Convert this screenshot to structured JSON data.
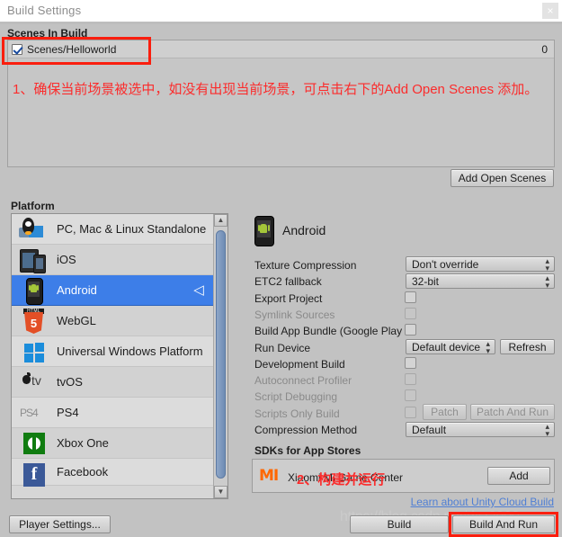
{
  "window": {
    "title": "Build Settings",
    "close_icon": "close-icon",
    "close_glyph": "×"
  },
  "scenes": {
    "header": "Scenes In Build",
    "index_label": "0",
    "items": [
      {
        "name": "Scenes/Helloworld",
        "checked": true,
        "index": "0"
      }
    ],
    "add_open_scenes_label": "Add Open Scenes"
  },
  "annotations": {
    "note1": "1、确保当前场景被选中，如没有出现当前场景，可点击右下的Add Open Scenes 添加。",
    "note2": "2、构建并运行",
    "highlight_color": "#fa1e0e"
  },
  "platform": {
    "header": "Platform",
    "selected": "Android",
    "items": [
      {
        "label": "PC, Mac & Linux Standalone",
        "icon": "standalone-icon"
      },
      {
        "label": "iOS",
        "icon": "ios-icon"
      },
      {
        "label": "Android",
        "icon": "android-icon"
      },
      {
        "label": "WebGL",
        "icon": "webgl-icon"
      },
      {
        "label": "Universal Windows Platform",
        "icon": "uwp-icon"
      },
      {
        "label": "tvOS",
        "icon": "tvos-icon"
      },
      {
        "label": "PS4",
        "icon": "ps4-icon"
      },
      {
        "label": "Xbox One",
        "icon": "xbox-icon"
      },
      {
        "label": "Facebook",
        "icon": "facebook-icon"
      }
    ],
    "unity_badge": "◁"
  },
  "details": {
    "title": "Android",
    "rows": [
      {
        "label": "Texture Compression",
        "type": "dropdown",
        "value": "Don't override",
        "disabled": false
      },
      {
        "label": "ETC2 fallback",
        "type": "dropdown",
        "value": "32-bit",
        "disabled": false
      },
      {
        "label": "Export Project",
        "type": "checkbox",
        "checked": false,
        "disabled": false
      },
      {
        "label": "Symlink Sources",
        "type": "checkbox",
        "checked": false,
        "disabled": true
      },
      {
        "label": "Build App Bundle (Google Play",
        "type": "checkbox",
        "checked": false,
        "disabled": false
      },
      {
        "label": "Run Device",
        "type": "dropdown-button",
        "value": "Default device",
        "button": "Refresh",
        "disabled": false
      },
      {
        "label": "Development Build",
        "type": "checkbox",
        "checked": false,
        "disabled": false
      },
      {
        "label": "Autoconnect Profiler",
        "type": "checkbox",
        "checked": false,
        "disabled": true
      },
      {
        "label": "Script Debugging",
        "type": "checkbox",
        "checked": false,
        "disabled": true
      },
      {
        "label": "Scripts Only Build",
        "type": "checkbox-buttons",
        "checked": false,
        "disabled": true,
        "buttons": [
          "Patch",
          "Patch And Run"
        ]
      },
      {
        "label": "Compression Method",
        "type": "dropdown",
        "value": "Default",
        "disabled": false
      }
    ]
  },
  "sdk": {
    "header": "SDKs for App Stores",
    "entry": "Xiaomi Mi Game Center",
    "logo_text": "MI",
    "logo_color": "#ff6700",
    "add_label": "Add"
  },
  "footer": {
    "cloud_build_link": "Learn about Unity Cloud Build",
    "player_settings_label": "Player Settings...",
    "build_label": "Build",
    "build_and_run_label": "Build And Run",
    "watermark": "https://blog.csdn.net/dxz2000"
  }
}
